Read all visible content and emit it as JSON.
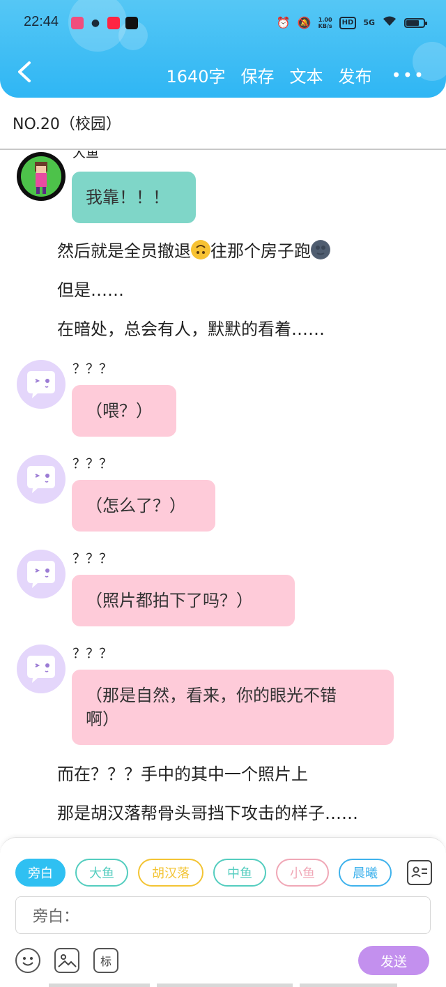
{
  "status_bar": {
    "time": "22:44",
    "net_speed_value": "1.00",
    "net_speed_unit": "KB/s",
    "hd_label": "HD",
    "signal_label": "5G",
    "battery_level": 0.75
  },
  "toolbar": {
    "word_count": "1640字",
    "save_label": "保存",
    "text_label": "文本",
    "publish_label": "发布",
    "more_label": "•••",
    "back_label": "‹"
  },
  "document": {
    "title": "NO.20（校园）"
  },
  "messages": [
    {
      "type": "chat",
      "speaker": "大鱼",
      "text": "我靠！！！",
      "bubble_color": "#7fd6c8"
    },
    {
      "type": "narration",
      "text_before": "然后就是全员撤退",
      "emoji1": "upside-down-face-emoji",
      "text_middle": "往那个房子跑",
      "emoji2": "new-moon-face-emoji"
    },
    {
      "type": "narration",
      "text": "但是……"
    },
    {
      "type": "narration",
      "text": "在暗处，总会有人，默默的看着……"
    },
    {
      "type": "chat",
      "speaker": "？？？",
      "text": "（喂？）",
      "bubble_color": "#fecbd9"
    },
    {
      "type": "chat",
      "speaker": "？？？",
      "text": "（怎么了？）",
      "bubble_color": "#fecbd9"
    },
    {
      "type": "chat",
      "speaker": "？？？",
      "text": "（照片都拍下了吗？）",
      "bubble_color": "#fecbd9"
    },
    {
      "type": "chat",
      "speaker": "？？？",
      "text_line1": "（那是自然，看来，你的眼光不错",
      "text_line2": "啊）",
      "bubble_color": "#fecbd9"
    },
    {
      "type": "narration",
      "text": "而在？？？手中的其中一个照片上"
    },
    {
      "type": "narration",
      "text": "那是胡汉落帮骨头哥挡下攻击的样子……"
    }
  ],
  "roles": [
    {
      "label": "旁白",
      "selected": true
    },
    {
      "label": "大鱼"
    },
    {
      "label": "胡汉落"
    },
    {
      "label": "中鱼"
    },
    {
      "label": "小鱼"
    },
    {
      "label": "晨曦"
    }
  ],
  "input": {
    "placeholder": "旁白："
  },
  "tools": {
    "marker_label": "标",
    "send_label": "发送"
  },
  "colors": {
    "header": "#2fb6f4",
    "accent_purple": "#c390ee",
    "bubble_teal": "#7fd6c8",
    "bubble_pink": "#fecbd9"
  }
}
